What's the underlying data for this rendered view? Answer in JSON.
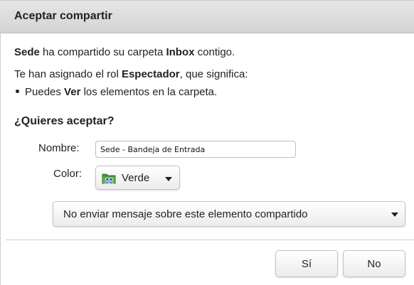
{
  "dialog": {
    "title": "Aceptar compartir",
    "line1": {
      "owner": "Sede",
      "mid": " ha compartido su carpeta ",
      "folder": "Inbox",
      "end": " contigo."
    },
    "line2": {
      "start": "Te han asignado el rol ",
      "role": "Espectador",
      "end": ", que significa:"
    },
    "bullet": {
      "start": "Puedes ",
      "action": "Ver",
      "end": " los elementos en la carpeta."
    },
    "question": "¿Quieres aceptar?",
    "name_label": "Nombre:",
    "name_value": "Sede - Bandeja de Entrada",
    "color_label": "Color:",
    "color_value": "Verde",
    "color_icon": "shared-folder-icon",
    "message_option": "No enviar mensaje sobre este elemento compartido",
    "yes_label": "Sí",
    "no_label": "No"
  },
  "colors": {
    "titlebar": "#d9d9d9",
    "folder_green": "#4a9a3a",
    "folder_blue": "#3a6fb7"
  }
}
